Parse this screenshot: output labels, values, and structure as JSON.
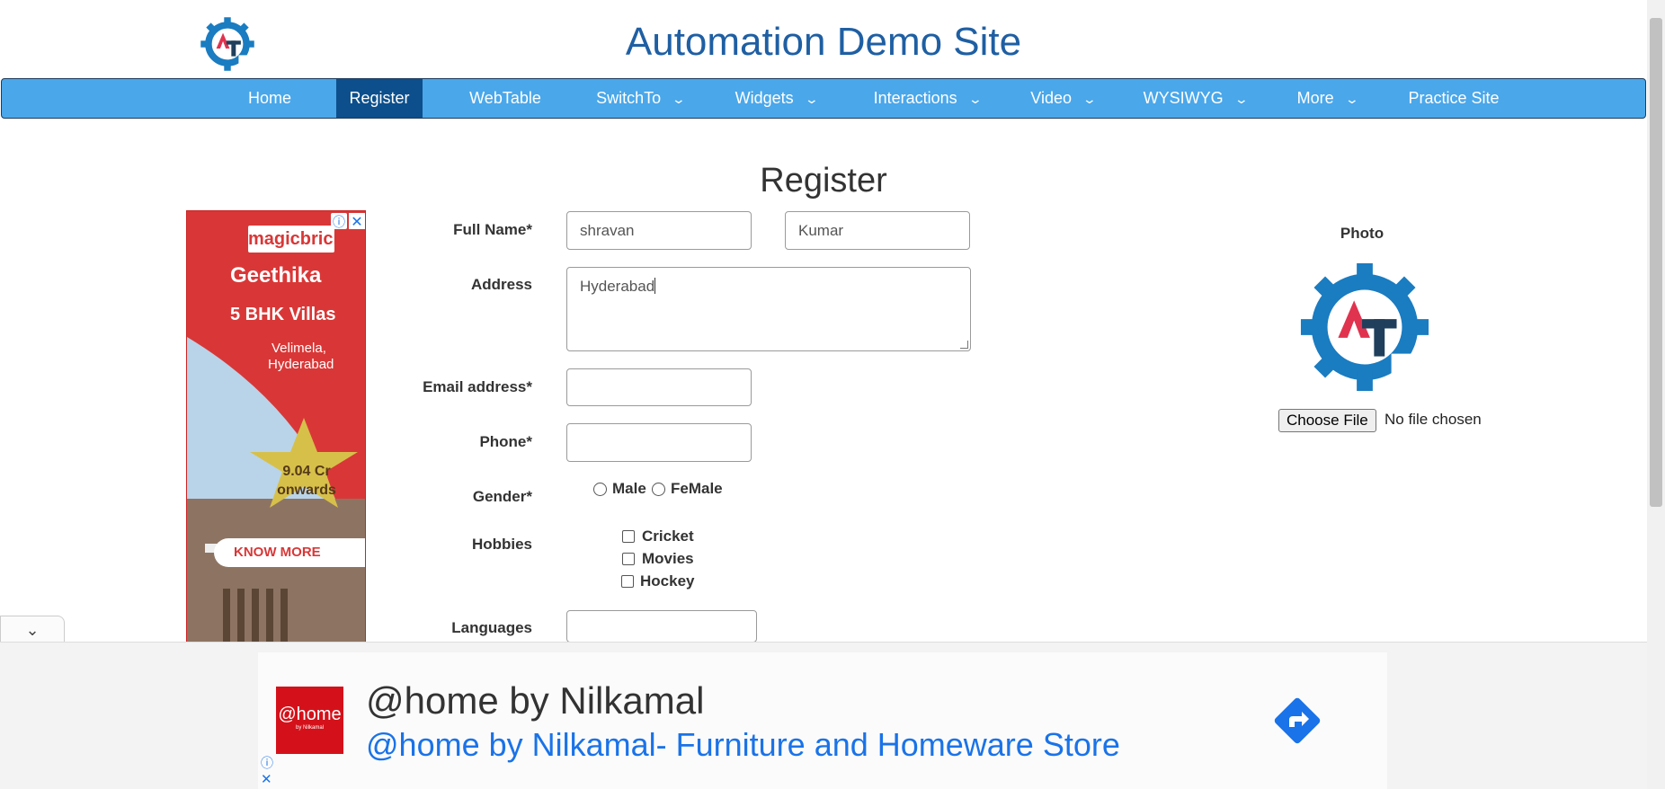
{
  "header": {
    "title": "Automation Demo Site",
    "logo_letters": "AT"
  },
  "nav": {
    "items": [
      {
        "label": "Home",
        "has_dropdown": false,
        "active": false
      },
      {
        "label": "Register",
        "has_dropdown": false,
        "active": true
      },
      {
        "label": "WebTable",
        "has_dropdown": false,
        "active": false
      },
      {
        "label": "SwitchTo",
        "has_dropdown": true,
        "active": false
      },
      {
        "label": "Widgets",
        "has_dropdown": true,
        "active": false
      },
      {
        "label": "Interactions",
        "has_dropdown": true,
        "active": false
      },
      {
        "label": "Video",
        "has_dropdown": true,
        "active": false
      },
      {
        "label": "WYSIWYG",
        "has_dropdown": true,
        "active": false
      },
      {
        "label": "More",
        "has_dropdown": true,
        "active": false
      },
      {
        "label": "Practice Site",
        "has_dropdown": false,
        "active": false
      }
    ]
  },
  "form": {
    "heading": "Register",
    "full_name_label": "Full Name*",
    "first_name_value": "shravan",
    "last_name_value": "Kumar",
    "address_label": "Address",
    "address_value": "Hyderabad",
    "email_label": "Email address*",
    "email_value": "",
    "phone_label": "Phone*",
    "phone_value": "",
    "gender_label": "Gender*",
    "gender_options": [
      "Male",
      "FeMale"
    ],
    "hobbies_label": "Hobbies",
    "hobbies_options": [
      "Cricket",
      "Movies",
      "Hockey"
    ],
    "languages_label": "Languages",
    "languages_value": ""
  },
  "photo": {
    "label": "Photo",
    "choose_file_label": "Choose File",
    "file_status": "No file chosen"
  },
  "side_ad": {
    "brand": "magicbricks",
    "project": "Geethika",
    "type": "5 BHK Villas",
    "location_line1": "Velimela,",
    "location_line2": "Hyderabad",
    "price_line1": "9.04 Cr",
    "price_line2": "onwards",
    "cta": "KNOW MORE",
    "info_icon": "info-icon",
    "close_icon": "close-icon",
    "brand_color": "#d93737"
  },
  "bottom_ad": {
    "logo_text": "@home",
    "logo_subtext": "by Nilkamal",
    "title": "@home by Nilkamal",
    "subtitle": "@home by Nilkamal- Furniture and Homeware Store",
    "link_color": "#1a73e8",
    "logo_color": "#d4111a"
  },
  "colors": {
    "nav_bg": "#4aa7ea",
    "nav_active": "#0c4f8c",
    "title_color": "#1f5fa3",
    "logo_blue": "#1a7cc1",
    "logo_red": "#e0334f",
    "logo_dark": "#1f3f5c"
  }
}
